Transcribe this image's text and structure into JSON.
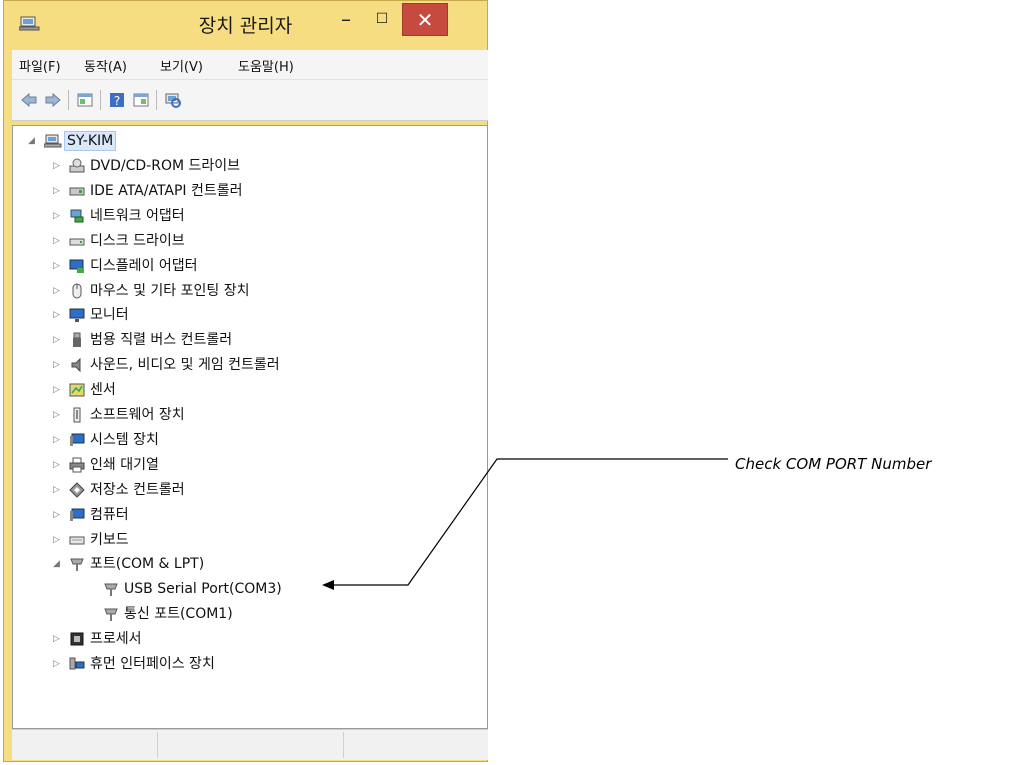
{
  "window": {
    "title": "장치 관리자",
    "min_glyph": "–",
    "max_glyph": "☐",
    "close_glyph": "✕"
  },
  "menu": [
    {
      "label": "파일(F)"
    },
    {
      "label": "동작(A)"
    },
    {
      "label": "보기(V)"
    },
    {
      "label": "도움말(H)"
    }
  ],
  "toolbar": {
    "icons": [
      "back-icon",
      "forward-icon",
      "properties-icon",
      "help-icon",
      "view-icon",
      "scan-hardware-icon"
    ]
  },
  "tree": {
    "root": {
      "label": "SY-KIM",
      "expanded": true
    },
    "items": [
      {
        "label": "DVD/CD-ROM 드라이브",
        "icon": "dvd-drive-icon",
        "expander": "▷"
      },
      {
        "label": "IDE ATA/ATAPI 컨트롤러",
        "icon": "ide-controller-icon",
        "expander": "▷"
      },
      {
        "label": "네트워크 어댑터",
        "icon": "network-adapter-icon",
        "expander": "▷"
      },
      {
        "label": "디스크 드라이브",
        "icon": "disk-drive-icon",
        "expander": "▷"
      },
      {
        "label": "디스플레이 어댑터",
        "icon": "display-adapter-icon",
        "expander": "▷"
      },
      {
        "label": "마우스 및 기타 포인팅 장치",
        "icon": "mouse-icon",
        "expander": "▷"
      },
      {
        "label": "모니터",
        "icon": "monitor-icon",
        "expander": "▷"
      },
      {
        "label": "범용 직렬 버스 컨트롤러",
        "icon": "usb-icon",
        "expander": "▷"
      },
      {
        "label": "사운드, 비디오 및 게임 컨트롤러",
        "icon": "speaker-icon",
        "expander": "▷"
      },
      {
        "label": "센서",
        "icon": "sensor-icon",
        "expander": "▷"
      },
      {
        "label": "소프트웨어 장치",
        "icon": "software-device-icon",
        "expander": "▷"
      },
      {
        "label": "시스템 장치",
        "icon": "system-device-icon",
        "expander": "▷"
      },
      {
        "label": "인쇄 대기열",
        "icon": "printer-icon",
        "expander": "▷"
      },
      {
        "label": "저장소 컨트롤러",
        "icon": "storage-controller-icon",
        "expander": "▷"
      },
      {
        "label": "컴퓨터",
        "icon": "computer-icon",
        "expander": "▷"
      },
      {
        "label": "키보드",
        "icon": "keyboard-icon",
        "expander": "▷"
      },
      {
        "label": "포트(COM & LPT)",
        "icon": "port-icon",
        "expander": "◢"
      },
      {
        "label": "USB Serial Port(COM3)",
        "icon": "port-icon",
        "expander": "",
        "child": true
      },
      {
        "label": "통신 포트(COM1)",
        "icon": "port-icon",
        "expander": "",
        "child": true
      },
      {
        "label": "프로세서",
        "icon": "processor-icon",
        "expander": "▷"
      },
      {
        "label": "휴먼 인터페이스 장치",
        "icon": "hid-icon",
        "expander": "▷"
      }
    ]
  },
  "annotation": {
    "text": "Check COM PORT Number"
  },
  "colors": {
    "frame": "#f7dd82",
    "close": "#c74a3f"
  }
}
